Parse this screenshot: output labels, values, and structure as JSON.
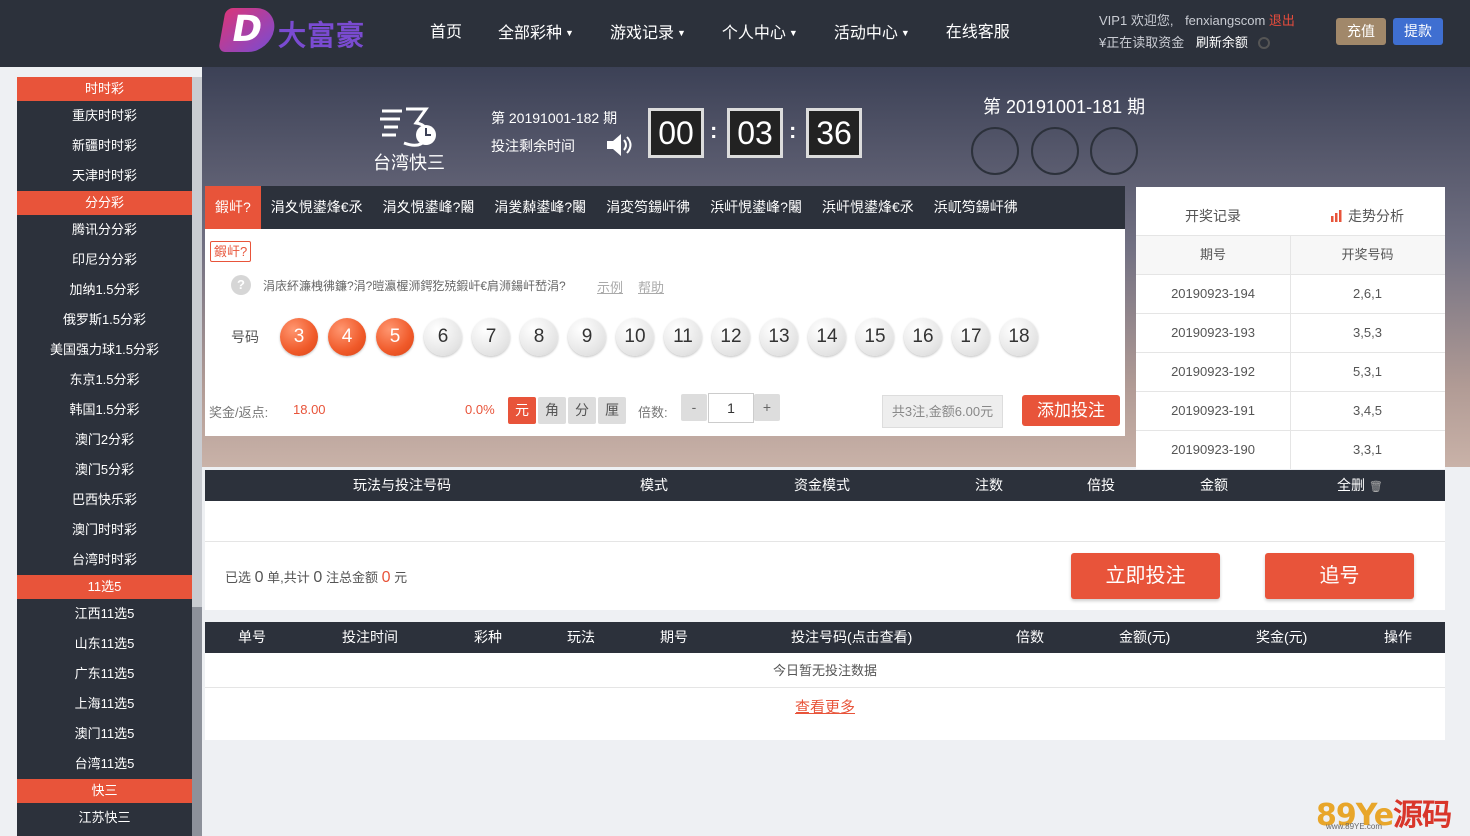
{
  "brand": {
    "logo_letter": "D",
    "logo_text": "大富豪"
  },
  "nav": [
    {
      "label": "首页",
      "dropdown": false
    },
    {
      "label": "全部彩种",
      "dropdown": true
    },
    {
      "label": "游戏记录",
      "dropdown": true
    },
    {
      "label": "个人中心",
      "dropdown": true
    },
    {
      "label": "活动中心",
      "dropdown": true
    },
    {
      "label": "在线客服",
      "dropdown": false
    }
  ],
  "user": {
    "level": "VIP1",
    "welcome": "欢迎您,",
    "name": "fenxiangscom",
    "logout": "退出",
    "balance_status": "¥正在读取资金",
    "refresh": "刷新余额",
    "recharge": "充值",
    "withdraw": "提款"
  },
  "sidebar": [
    {
      "section": "时时彩",
      "items": [
        "重庆时时彩",
        "新疆时时彩",
        "天津时时彩"
      ]
    },
    {
      "section": "分分彩",
      "items": [
        "腾讯分分彩",
        "印尼分分彩",
        "加纳1.5分彩",
        "俄罗斯1.5分彩",
        "美国强力球1.5分彩",
        "东京1.5分彩",
        "韩国1.5分彩",
        "澳门2分彩",
        "澳门5分彩",
        "巴西快乐彩",
        "澳门时时彩",
        "台湾时时彩"
      ]
    },
    {
      "section": "11选5",
      "items": [
        "江西11选5",
        "山东11选5",
        "广东11选5",
        "上海11选5",
        "澳门11选5",
        "台湾11选5"
      ]
    },
    {
      "section": "快三",
      "items": [
        "江苏快三"
      ]
    }
  ],
  "game": {
    "name": "台湾快三",
    "current_period": "第 20191001-182 期",
    "remain_label": "投注剩余时间",
    "countdown": [
      "00",
      "03",
      "36"
    ],
    "last_period": "第 20191001-181 期"
  },
  "tabs": [
    "鍜屽?",
    "涓夊悓鍙烽€氶",
    "涓夊悓鍙峰?闂",
    "涓夎繛鍙峰?闂",
    "涓変笉鍚屽彿",
    "浜屽悓鍙峰?闂",
    "浜屽悓鍙烽€氶",
    "浜屼笉鍚屽彿"
  ],
  "subtab": "鍜屽?",
  "hint": {
    "text": "涓庡紑濂栧彿鐮?涓?暟瀛楃浉鍔犵殑鍜屽€肩浉鍚屽嵆涓?",
    "example": "示例",
    "help": "帮助"
  },
  "numbers": {
    "label": "号码",
    "balls": [
      "3",
      "4",
      "5",
      "6",
      "7",
      "8",
      "9",
      "10",
      "11",
      "12",
      "13",
      "14",
      "15",
      "16",
      "17",
      "18"
    ],
    "selected": [
      "3",
      "4",
      "5"
    ]
  },
  "bet": {
    "bonus_label": "奖金/返点:",
    "bonus_value": "18.00",
    "rebate": "0.0%",
    "units": [
      "元",
      "角",
      "分",
      "厘"
    ],
    "unit_selected": "元",
    "multiple_label": "倍数:",
    "minus": "-",
    "plus": "+",
    "multiple": "1",
    "total": "共3注,金额6.00元",
    "add_button": "添加投注"
  },
  "draws": {
    "tab_records": "开奖记录",
    "tab_trend": "走势分析",
    "headers": [
      "期号",
      "开奖号码"
    ],
    "rows": [
      [
        "20190923-194",
        "2,6,1"
      ],
      [
        "20190923-193",
        "3,5,3"
      ],
      [
        "20190923-192",
        "5,3,1"
      ],
      [
        "20190923-191",
        "3,4,5"
      ],
      [
        "20190923-190",
        "3,3,1"
      ]
    ]
  },
  "cart": {
    "headers": [
      "玩法与投注号码",
      "模式",
      "资金模式",
      "注数",
      "倍投",
      "金额",
      "全删"
    ],
    "summary": {
      "p1": "已选",
      "n1": "0",
      "p2": "单,共计",
      "n2": "0",
      "p3": "注总金额",
      "n3": "0",
      "p4": "元"
    },
    "bet_now": "立即投注",
    "chase": "追号"
  },
  "orders": {
    "headers": [
      "单号",
      "投注时间",
      "彩种",
      "玩法",
      "期号",
      "投注号码(点击查看)",
      "倍数",
      "金额(元)",
      "奖金(元)",
      "操作"
    ],
    "empty": "今日暂无投注数据",
    "more": "查看更多"
  },
  "watermark": {
    "a": "89Ye",
    "b": "源码",
    "url": "www.89YE.com"
  },
  "colors": {
    "accent": "#e8543a",
    "dark": "#2c313b",
    "recharge": "#a1886a",
    "withdraw": "#3f6fd1"
  }
}
